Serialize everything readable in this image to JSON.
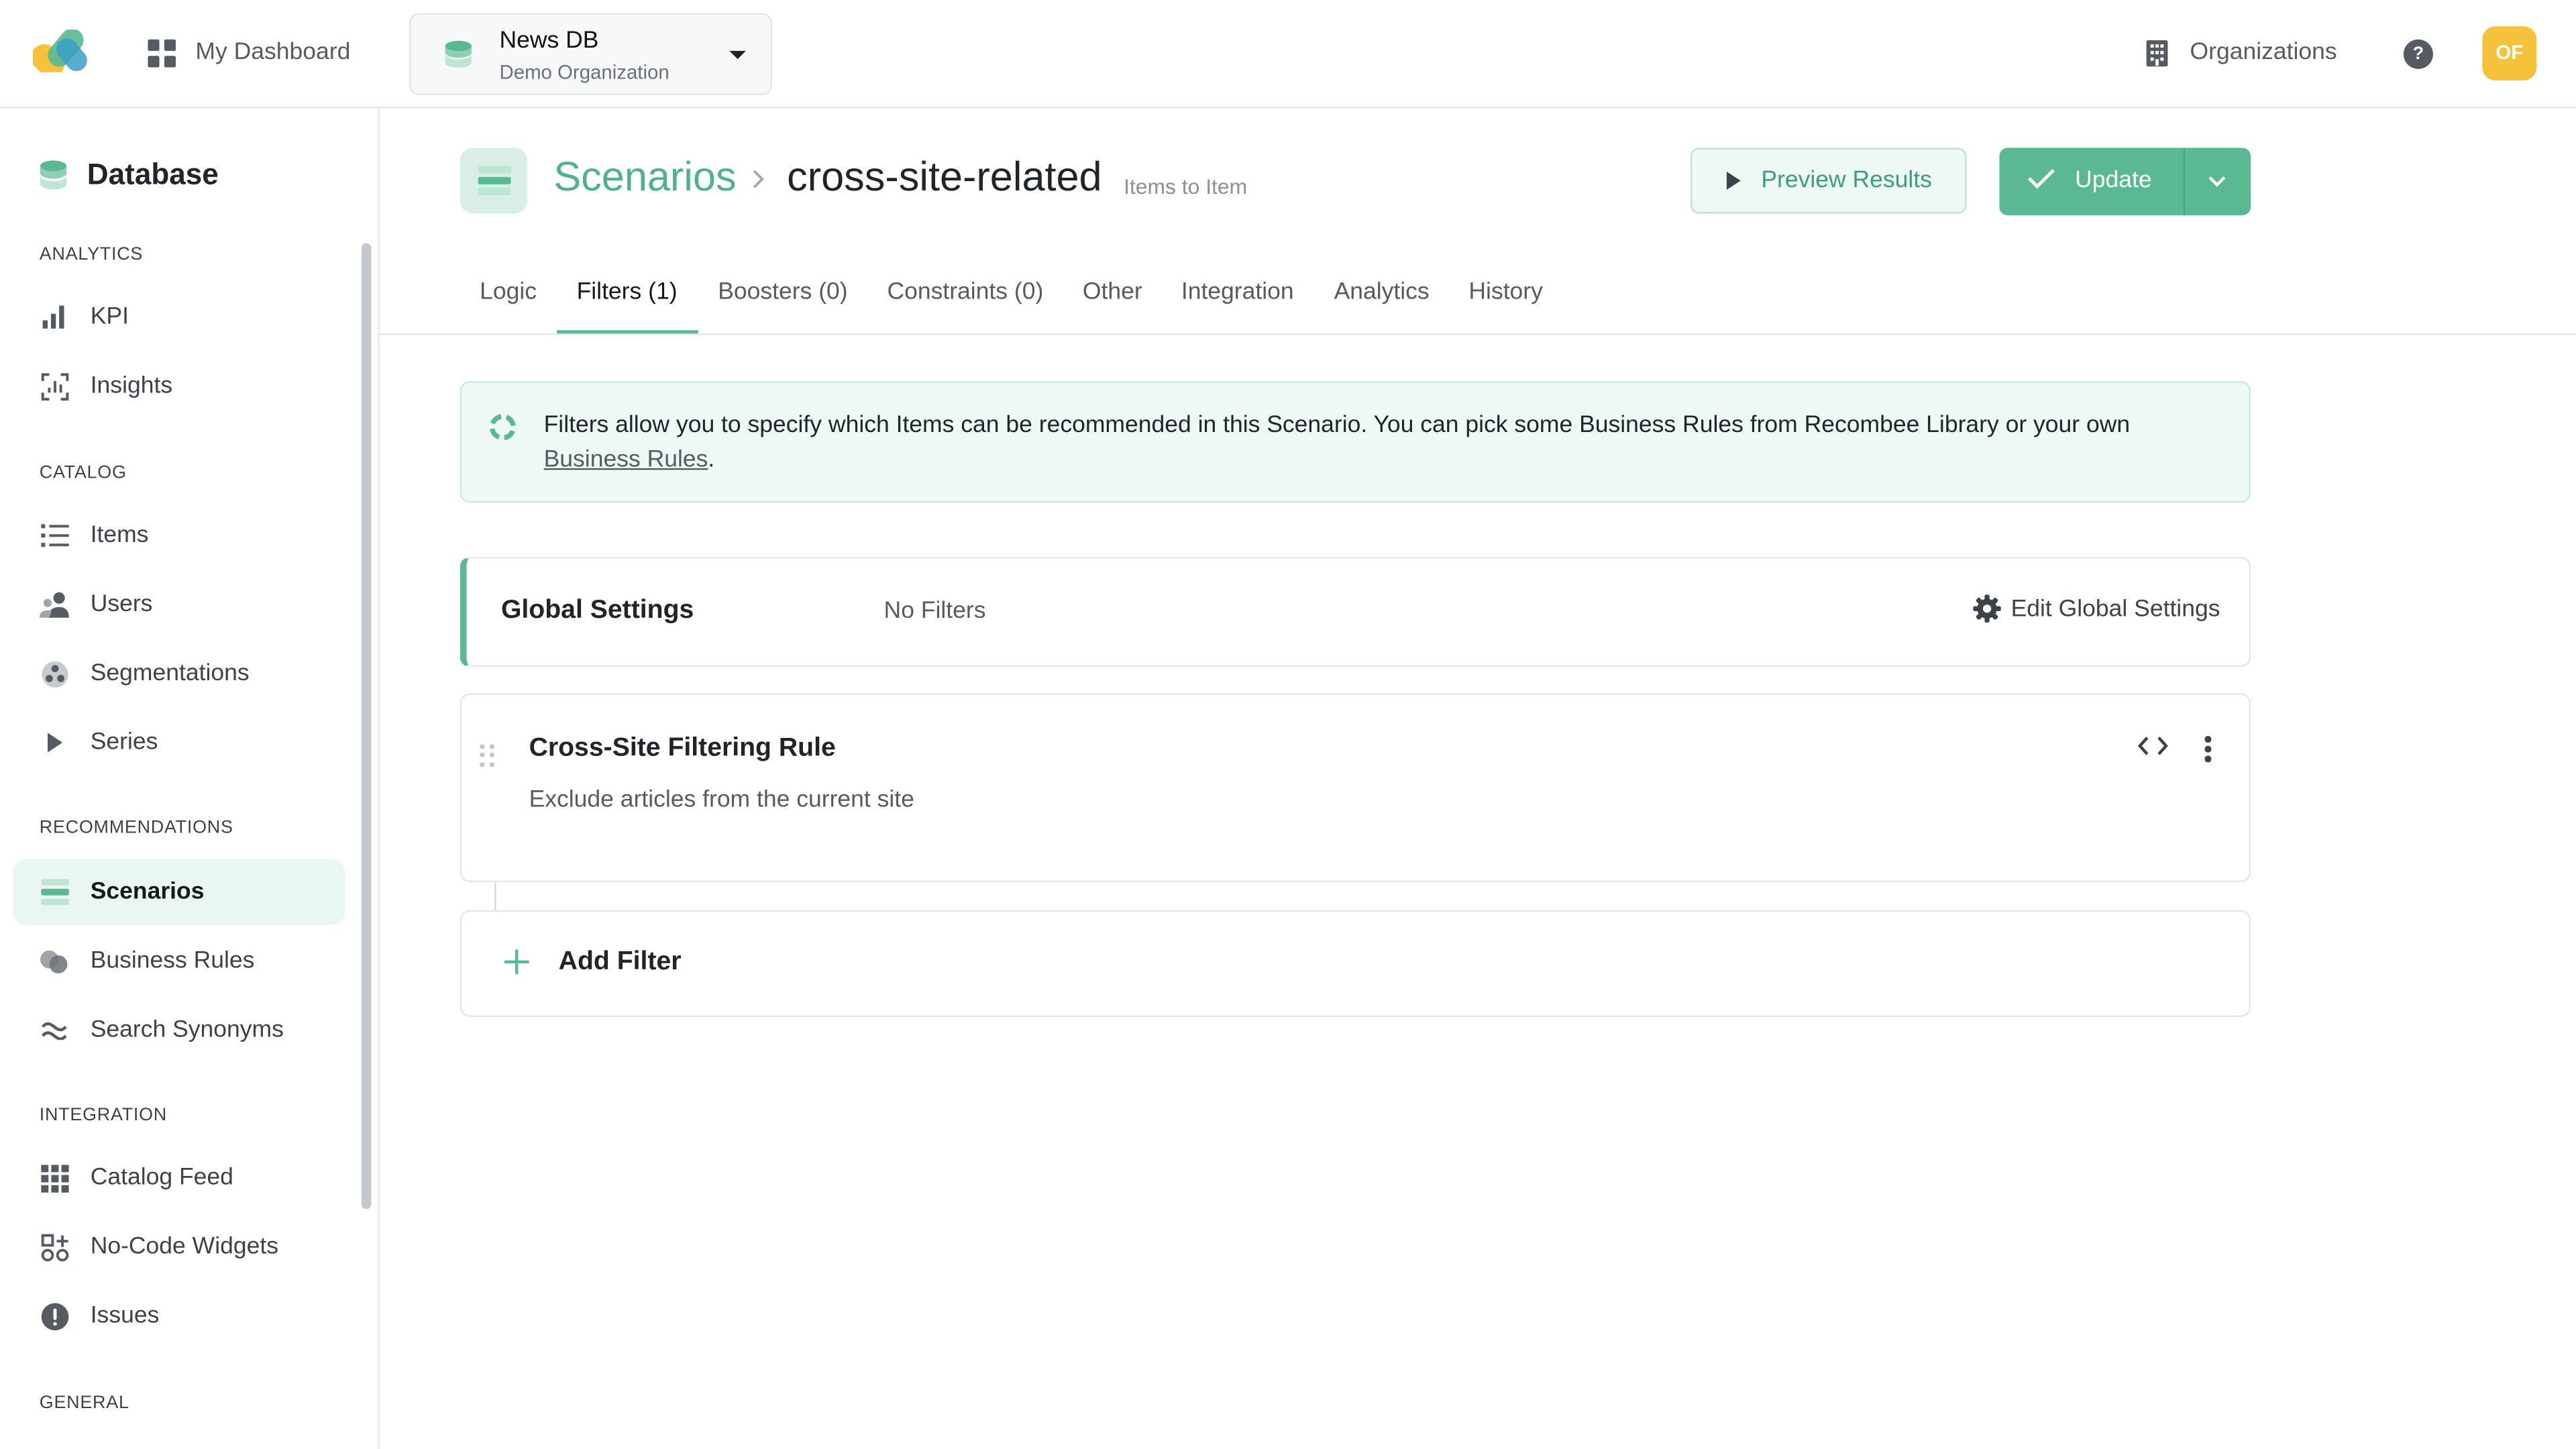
{
  "topbar": {
    "dashboard_label": "My Dashboard",
    "database": {
      "name": "News DB",
      "organization": "Demo Organization"
    },
    "organizations_label": "Organizations",
    "help_label": "?",
    "avatar_initials": "OF"
  },
  "sidebar": {
    "title": "Database",
    "sections": {
      "analytics": "ANALYTICS",
      "catalog": "CATALOG",
      "recommendations": "RECOMMENDATIONS",
      "integration": "INTEGRATION",
      "general": "GENERAL"
    },
    "items": {
      "kpi": "KPI",
      "insights": "Insights",
      "items": "Items",
      "users": "Users",
      "segmentations": "Segmentations",
      "series": "Series",
      "scenarios": "Scenarios",
      "business_rules": "Business Rules",
      "search_synonyms": "Search Synonyms",
      "catalog_feed": "Catalog Feed",
      "no_code_widgets": "No-Code Widgets",
      "issues": "Issues"
    },
    "active_item": "Scenarios"
  },
  "header": {
    "breadcrumb_root": "Scenarios",
    "breadcrumb_separator": ">",
    "current": "cross-site-related",
    "subtitle": "Items to Item",
    "preview_label": "Preview Results",
    "update_label": "Update"
  },
  "tabs": {
    "logic": "Logic",
    "filters": "Filters (1)",
    "boosters": "Boosters (0)",
    "constraints": "Constraints (0)",
    "other": "Other",
    "integration": "Integration",
    "analytics": "Analytics",
    "history": "History",
    "active": "Filters (1)"
  },
  "info": {
    "text": "Filters allow you to specify which Items can be recommended in this Scenario. You can pick some Business Rules from Recombee Library or your own ",
    "link": "Business Rules",
    "end": "."
  },
  "global_settings": {
    "title": "Global Settings",
    "value": "No Filters",
    "edit_label": "Edit Global Settings"
  },
  "filter_rule": {
    "title": "Cross-Site Filtering Rule",
    "description": "Exclude articles from the current site"
  },
  "add_filter_label": "Add Filter",
  "colors": {
    "accent": "#5ab992",
    "accent_dark": "#4fb28c",
    "accent_light": "#eef8f4",
    "avatar": "#f5c33b"
  }
}
